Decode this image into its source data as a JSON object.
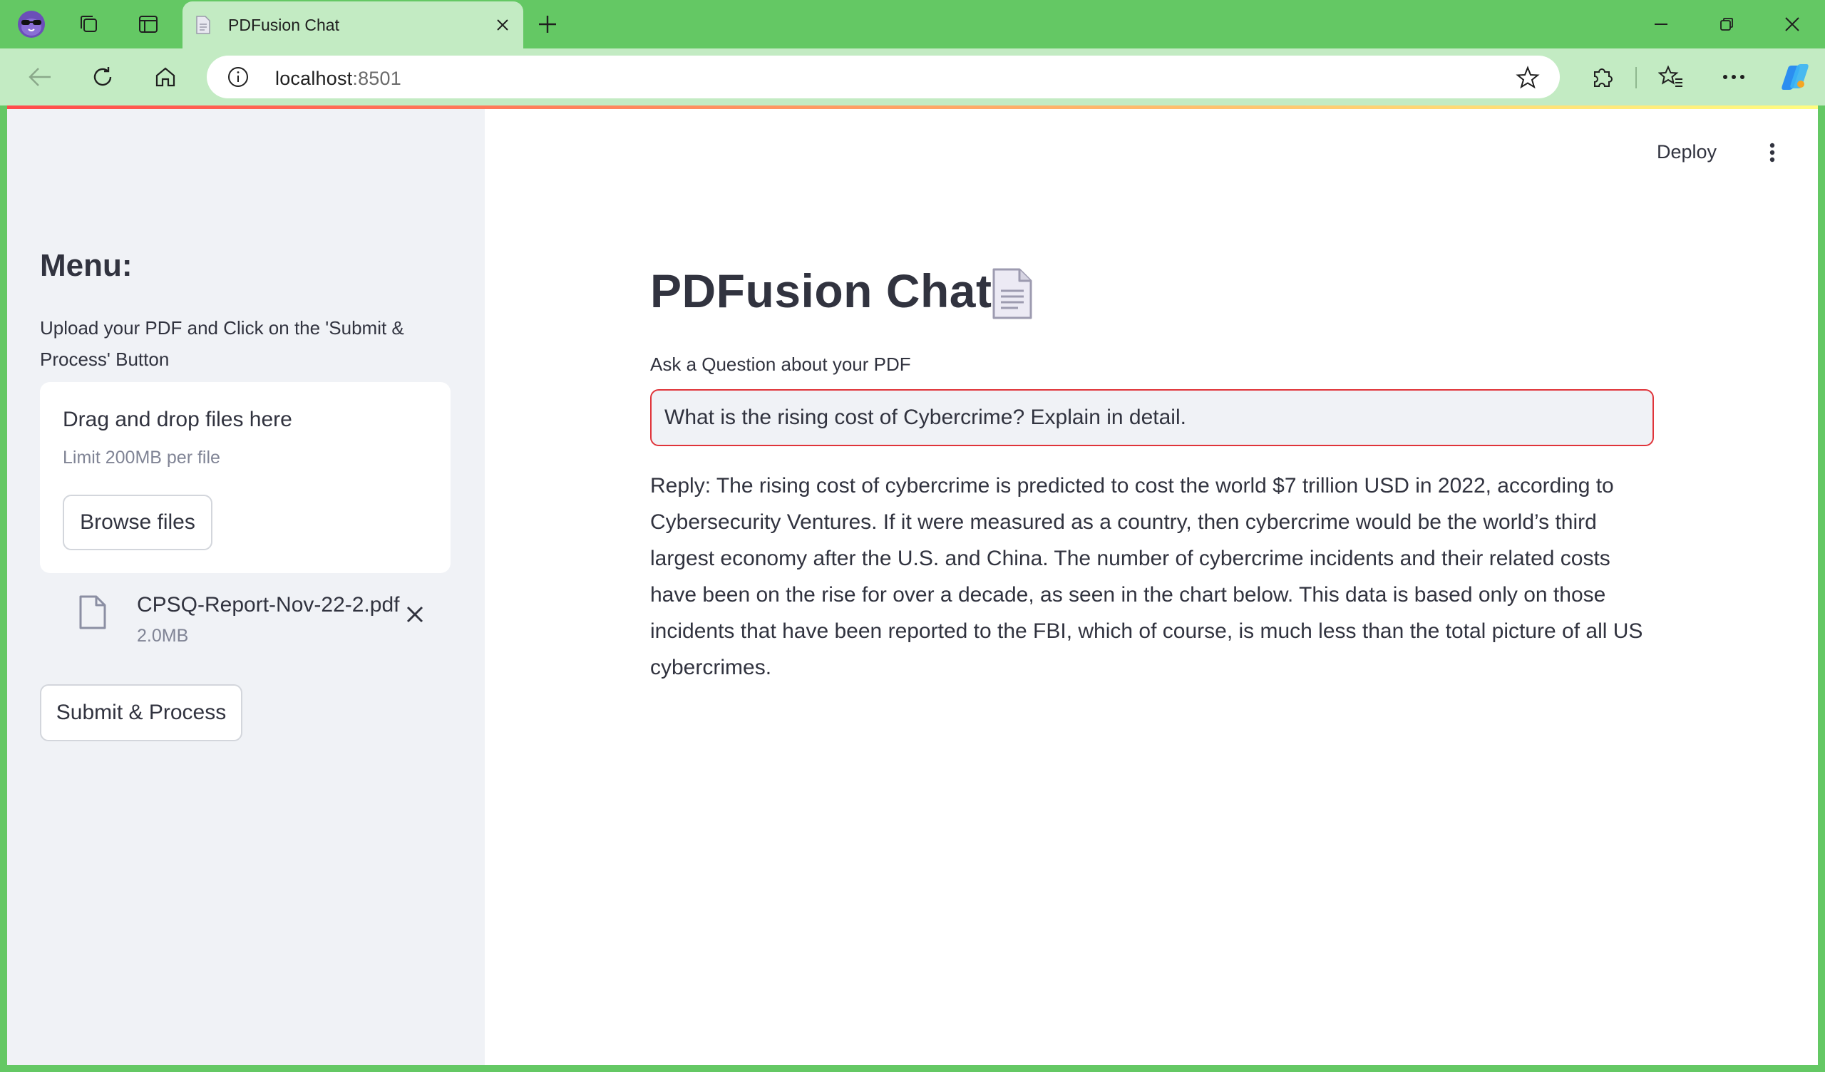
{
  "browser": {
    "tab": {
      "title": "PDFusion Chat"
    },
    "address": {
      "host": "localhost",
      "port": ":8501"
    },
    "icons": {
      "profile": "owl-profile-icon",
      "collections": "collections-icon",
      "vertical_tabs": "tab-actions-icon",
      "new_tab": "plus-icon",
      "minimize": "minimize-icon",
      "restore": "restore-icon",
      "close": "close-icon",
      "extensions": "puzzle-icon",
      "favorites": "favorites-icon",
      "more": "ellipsis-icon",
      "copilot": "copilot-icon"
    }
  },
  "sidebar": {
    "title": "Menu:",
    "description": "Upload your PDF and Click on the 'Submit & Process' Button",
    "uploader": {
      "drop_title": "Drag and drop files here",
      "limit": "Limit 200MB per file",
      "browse_label": "Browse files"
    },
    "file": {
      "name": "CPSQ-Report-Nov-22-2.pdf",
      "size": "2.0MB"
    },
    "submit_label": "Submit & Process"
  },
  "header": {
    "deploy_label": "Deploy"
  },
  "main": {
    "title": "PDFusion Chat",
    "question_label": "Ask a Question about your PDF",
    "question_value": "What is the rising cost of Cybercrime? Explain in detail.",
    "reply": "Reply: The rising cost of cybercrime is predicted to cost the world $7 trillion USD in 2022, according to Cybersecurity Ventures. If it were measured as a country, then cybercrime would be the world’s third largest economy after the U.S. and China. The number of cybercrime incidents and their related costs have been on the rise for over a decade, as seen in the chart below. This data is based only on those incidents that have been reported to the FBI, which of course, is much less than the total picture of all US cybercrimes."
  },
  "colors": {
    "chrome_green": "#64c864",
    "toolbar_green": "#c3ebc3",
    "sidebar_bg": "#f0f2f6",
    "input_border_focus": "#e0343a",
    "text": "#31333f"
  }
}
